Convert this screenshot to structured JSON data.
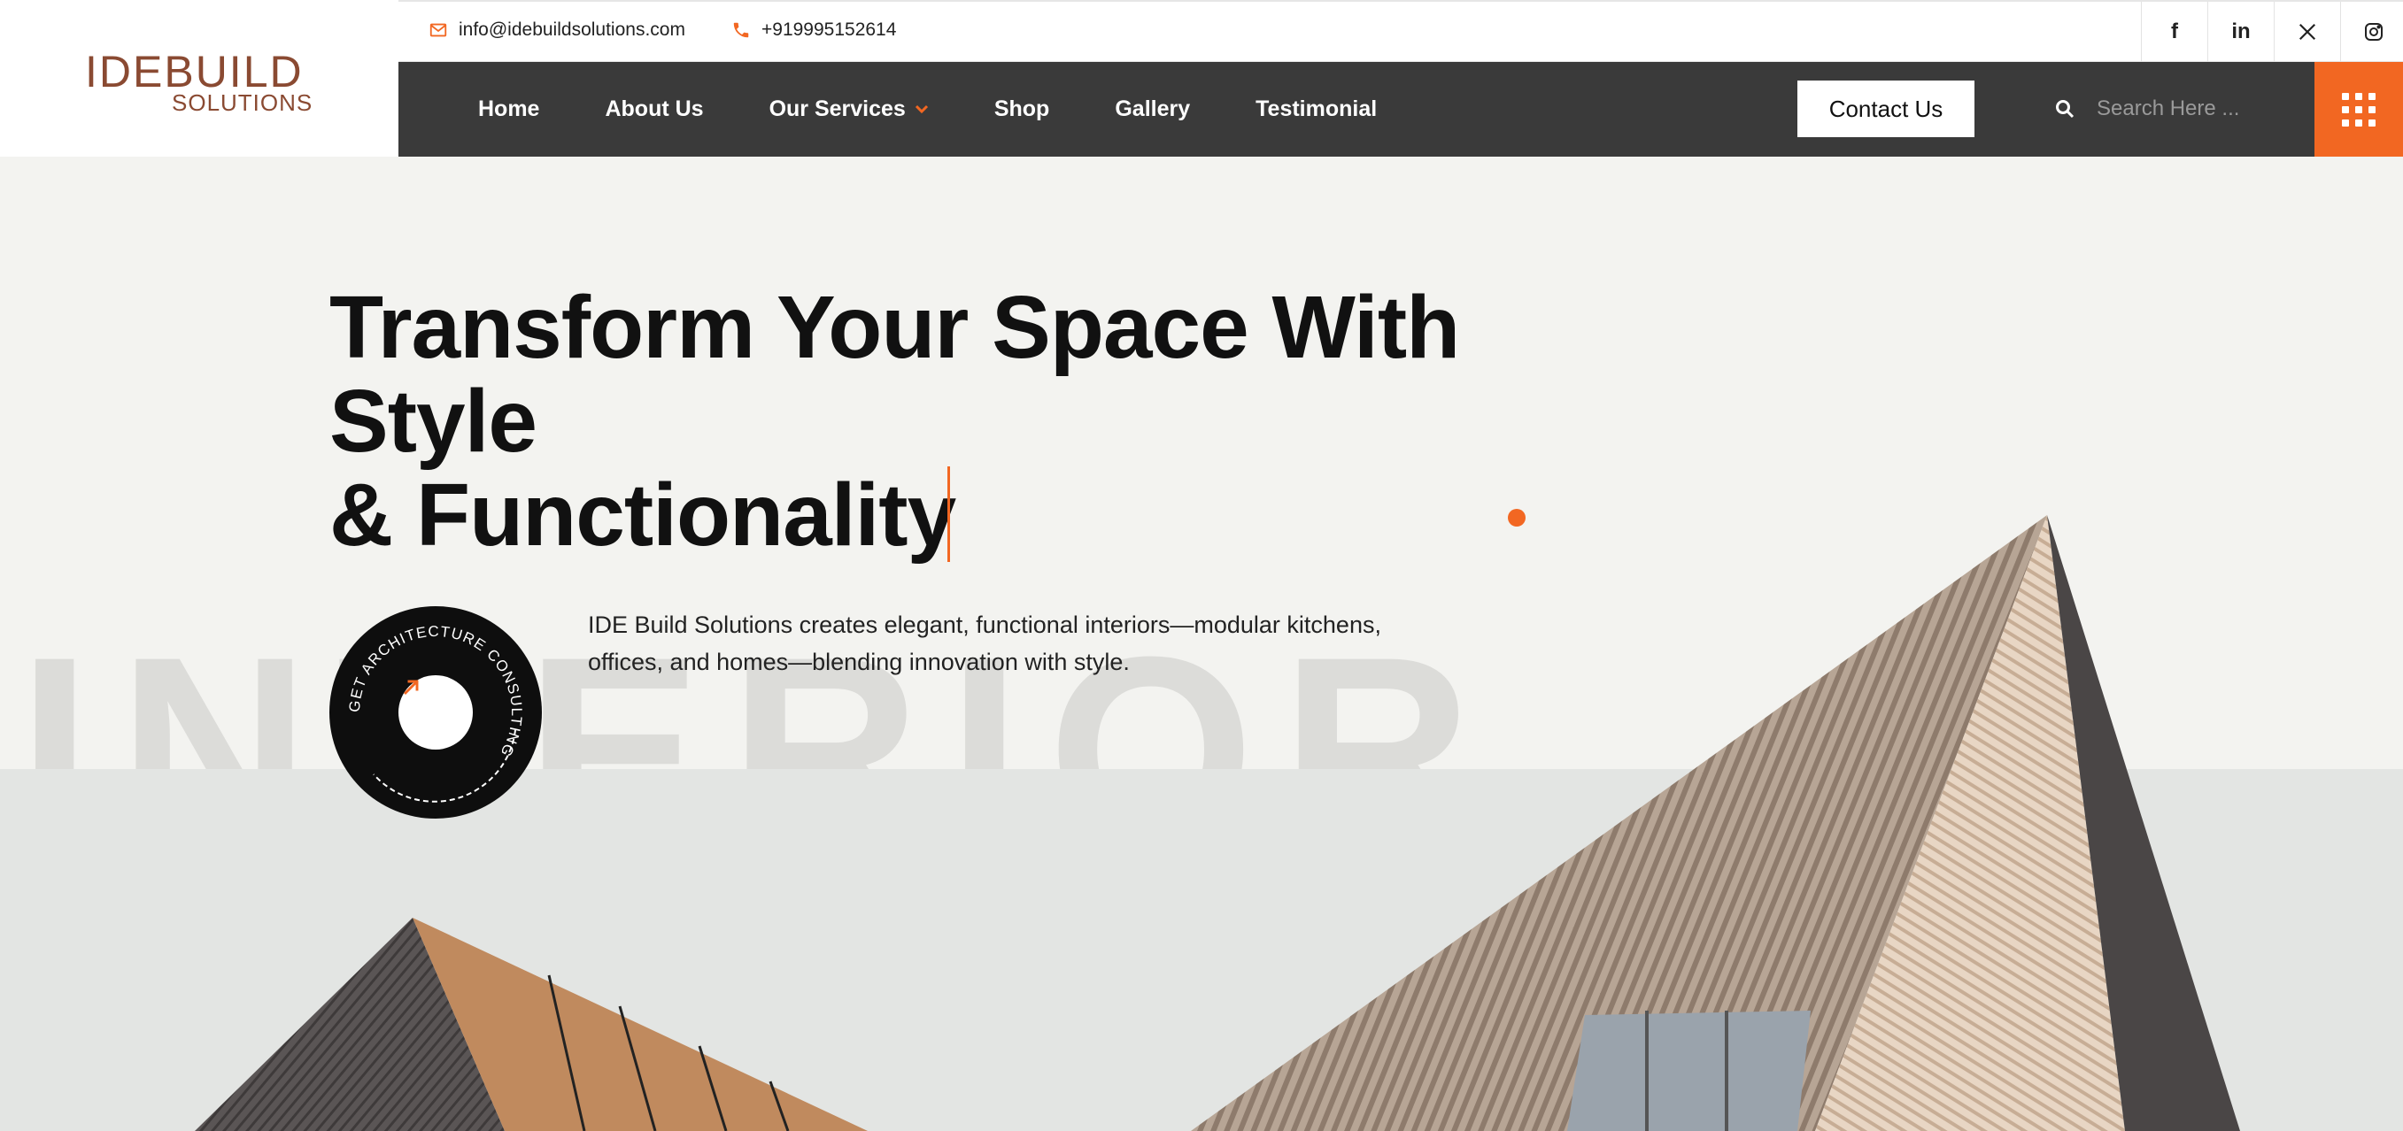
{
  "brand": {
    "logo_main": "IDEBUILD",
    "logo_sub": "SOLUTIONS",
    "accent_color": "#f26722",
    "logo_color": "#8a4a32"
  },
  "topbar": {
    "email": "info@idebuildsolutions.com",
    "phone": "+919995152614",
    "email_icon": "mail-icon",
    "phone_icon": "phone-icon",
    "social": [
      {
        "name": "facebook-icon",
        "glyph": "f"
      },
      {
        "name": "linkedin-icon",
        "glyph": "in"
      },
      {
        "name": "x-icon",
        "glyph": "𝕏"
      },
      {
        "name": "instagram-icon",
        "glyph": "◎"
      }
    ]
  },
  "nav": {
    "items": [
      {
        "label": "Home"
      },
      {
        "label": "About Us"
      },
      {
        "label": "Our Services",
        "has_dropdown": true
      },
      {
        "label": "Shop"
      },
      {
        "label": "Gallery"
      },
      {
        "label": "Testimonial"
      }
    ],
    "contact_button": "Contact Us",
    "search_placeholder": "Search Here ...",
    "menu_icon": "grid-menu-icon"
  },
  "hero": {
    "headline_line1": "Transform Your Space With",
    "headline_line2": "Style",
    "headline_line3": "& Functionality",
    "watermark": "INTERIOR",
    "description": "IDE Build Solutions creates elegant, functional interiors—modular kitchens, offices, and homes—blending innovation with style.",
    "badge_text": "GET ARCHITECTURE CONSULTING",
    "badge_icon": "arrow-up-right-icon"
  }
}
